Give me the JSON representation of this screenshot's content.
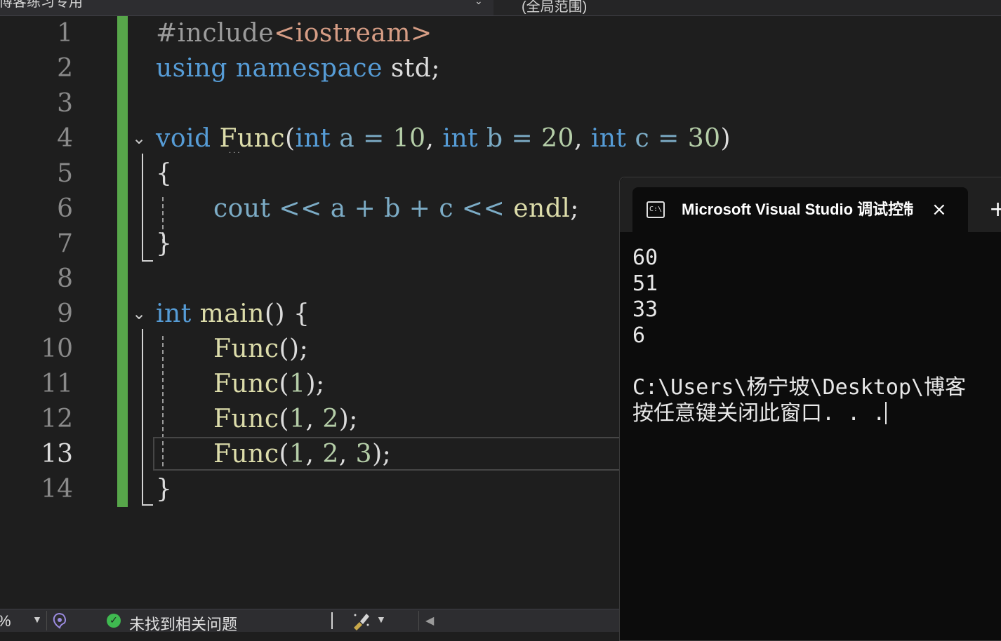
{
  "topbar": {
    "project_selector": "博客练习专用",
    "scope_selector": "(全局范围)"
  },
  "editor": {
    "line_numbers": [
      "1",
      "2",
      "3",
      "4",
      "5",
      "6",
      "7",
      "8",
      "9",
      "10",
      "11",
      "12",
      "13",
      "14"
    ],
    "current_line": "13",
    "code": {
      "l1": {
        "pp": "#include",
        "str": "<iostream>"
      },
      "l2": {
        "kw1": "using",
        "kw2": "namespace",
        "rest": " std;"
      },
      "l4": {
        "kw_void": "void",
        "fn": "Func",
        "p1": "(",
        "kw_int1": "int",
        "a": " a = ",
        "n1": "10",
        "c1": ", ",
        "kw_int2": "int",
        "b": " b = ",
        "n2": "20",
        "c2": ", ",
        "kw_int3": "int",
        "c": " c = ",
        "n3": "30",
        "p2": ")"
      },
      "l5": "{",
      "l6": {
        "cout": "cout << a + b + c << ",
        "endl": "endl",
        "semi": ";"
      },
      "l7": "}",
      "l9": {
        "kw": "int",
        "fn": "main",
        "rest": "() {"
      },
      "l10": {
        "fn": "Func",
        "rest": "();"
      },
      "l11": {
        "fn": "Func",
        "open": "(",
        "n1": "1",
        "close": ");"
      },
      "l12": {
        "fn": "Func",
        "open": "(",
        "n1": "1",
        "sep": ", ",
        "n2": "2",
        "close": ");"
      },
      "l13": {
        "fn": "Func",
        "open": "(",
        "n1": "1",
        "sep1": ", ",
        "n2": "2",
        "sep2": ", ",
        "n3": "3",
        "close": ");"
      },
      "l14": "}"
    }
  },
  "console": {
    "tab_title": "Microsoft Visual Studio 调试控制台",
    "close_icon": "×",
    "new_tab_icon": "+",
    "output_lines": [
      "60",
      "51",
      "33",
      "6",
      "",
      "C:\\Users\\杨宁坡\\Desktop\\博客",
      "按任意键关闭此窗口. . ."
    ]
  },
  "statusbar": {
    "zoom": "%",
    "issues_text": "未找到相关问题"
  },
  "colors": {
    "keyword": "#569cd6",
    "function": "#dcdcaa",
    "number": "#b5cea8",
    "string": "#d69d85",
    "change_bar": "#57a64a",
    "ok": "#3fb950"
  }
}
